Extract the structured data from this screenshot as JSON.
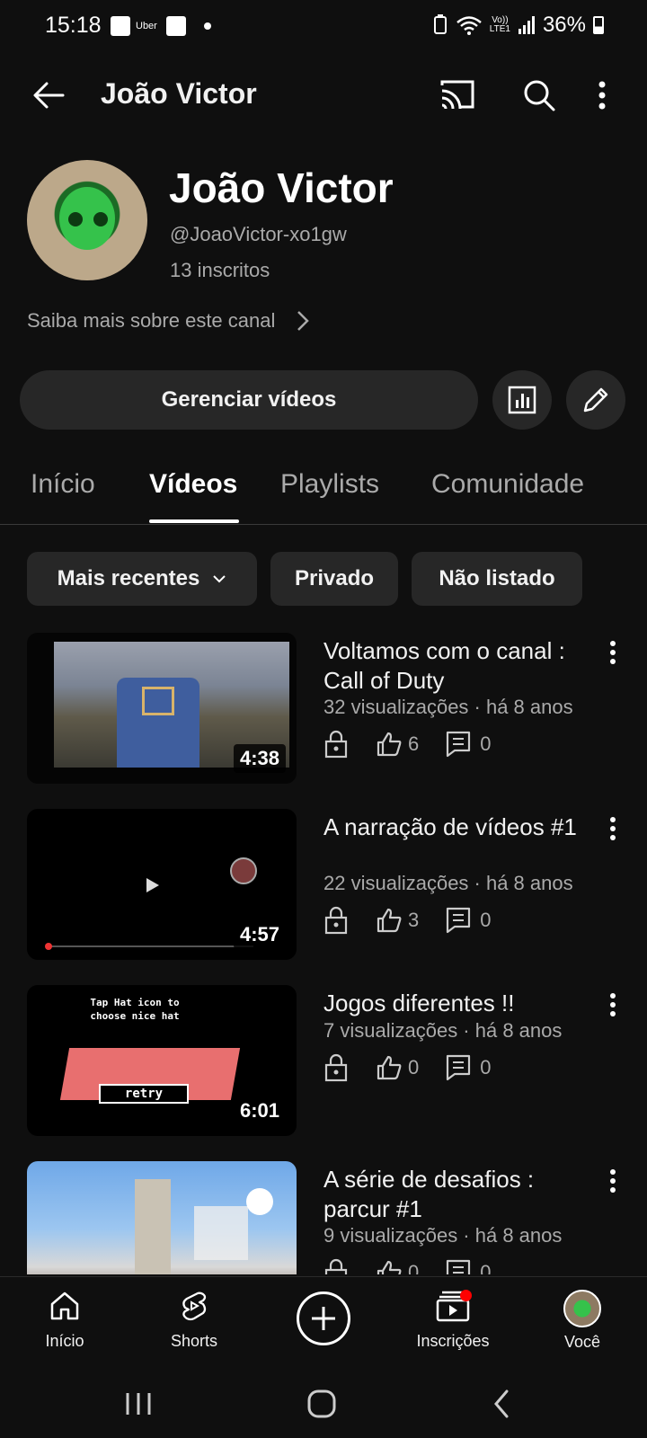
{
  "status_bar": {
    "time": "15:18",
    "uber_label": "Uber",
    "net_top": "Vo))",
    "net_bottom": "LTE1",
    "battery": "36%"
  },
  "app_bar": {
    "title": "João Victor"
  },
  "channel": {
    "name": "João Victor",
    "handle": "@JoaoVictor-xo1gw",
    "subscribers": "13 inscritos",
    "more_link": "Saiba mais sobre este canal"
  },
  "actions": {
    "manage_label": "Gerenciar vídeos"
  },
  "tabs": [
    {
      "label": "Início"
    },
    {
      "label": "Vídeos"
    },
    {
      "label": "Playlists"
    },
    {
      "label": "Comunidade"
    }
  ],
  "chips": [
    {
      "label": "Mais recentes"
    },
    {
      "label": "Privado"
    },
    {
      "label": "Não listado"
    }
  ],
  "videos": [
    {
      "title": "Voltamos com o canal : Call of Duty",
      "meta": "32 visualizações · há 8 anos",
      "duration": "4:38",
      "likes": "6",
      "comments": "0"
    },
    {
      "title": "A narração de vídeos #1",
      "meta": "22 visualizações · há 8 anos",
      "duration": "4:57",
      "likes": "3",
      "comments": "0"
    },
    {
      "title": "Jogos diferentes !!",
      "meta": "7 visualizações · há 8 anos",
      "duration": "6:01",
      "likes": "0",
      "comments": "0"
    },
    {
      "title": "A série de desafios : parcur #1",
      "meta": "9 visualizações · há 8 anos",
      "duration": "",
      "likes": "0",
      "comments": "0"
    }
  ],
  "thumb_text": {
    "game_line1": "Tap Hat icon to",
    "game_line2": "choose nice hat",
    "retry": "retry"
  },
  "bottom_nav": [
    {
      "label": "Início"
    },
    {
      "label": "Shorts"
    },
    {
      "label": "Inscrições"
    },
    {
      "label": "Você"
    }
  ],
  "colors": {
    "background": "#0f0f0f",
    "surface": "#272727",
    "text_primary": "#f1f1f1",
    "text_secondary": "#aaaaaa",
    "notification": "#ff0000"
  }
}
